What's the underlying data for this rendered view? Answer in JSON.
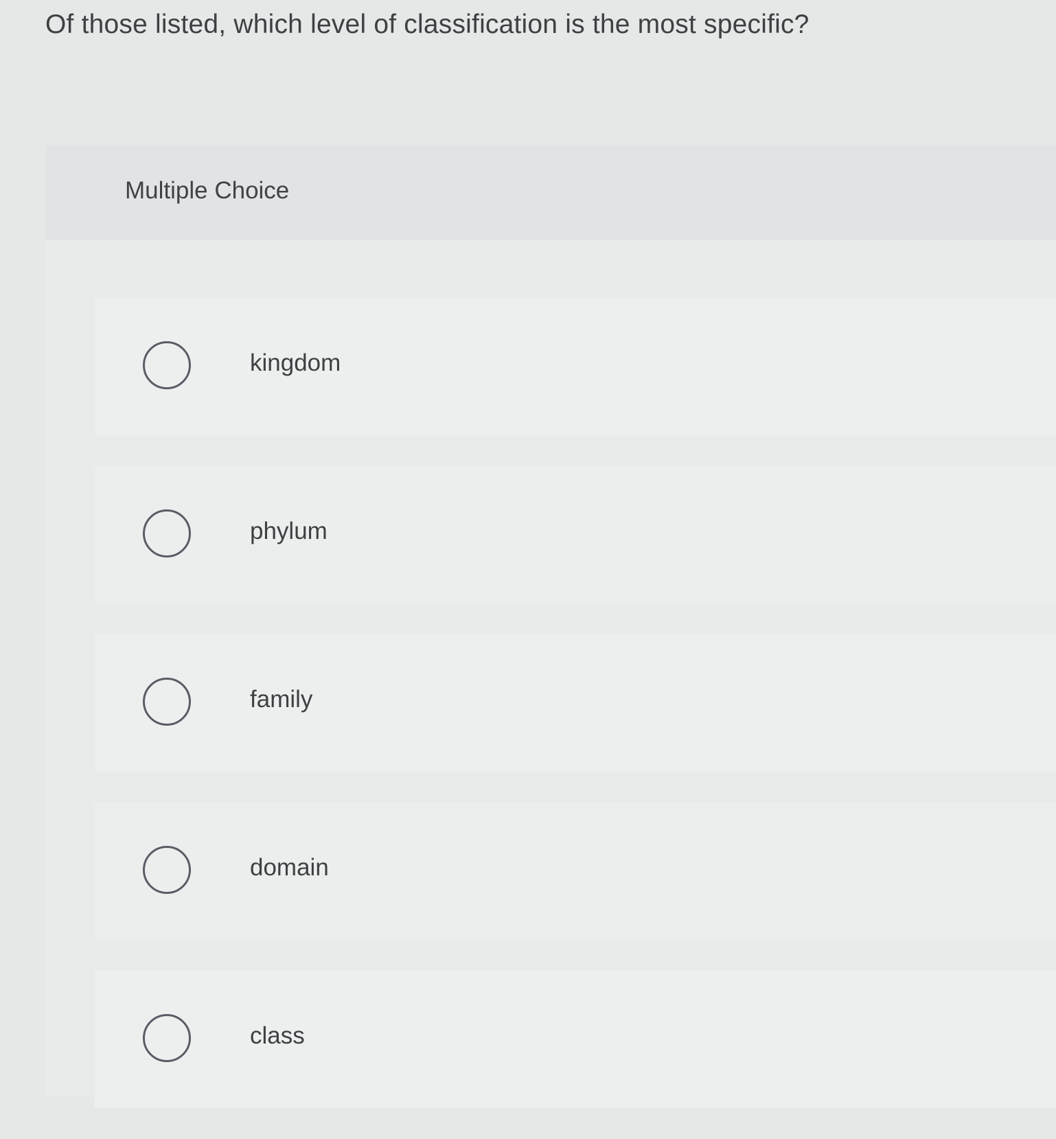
{
  "question": {
    "text": "Of those listed, which level of classification is the most specific?"
  },
  "panel": {
    "type_label": "Multiple Choice"
  },
  "options": [
    {
      "label": "kingdom"
    },
    {
      "label": "phylum"
    },
    {
      "label": "family"
    },
    {
      "label": "domain"
    },
    {
      "label": "class"
    }
  ],
  "colors": {
    "background": "#e6e8e8",
    "text": "#3e4043",
    "radio_border": "#5a5c65"
  }
}
